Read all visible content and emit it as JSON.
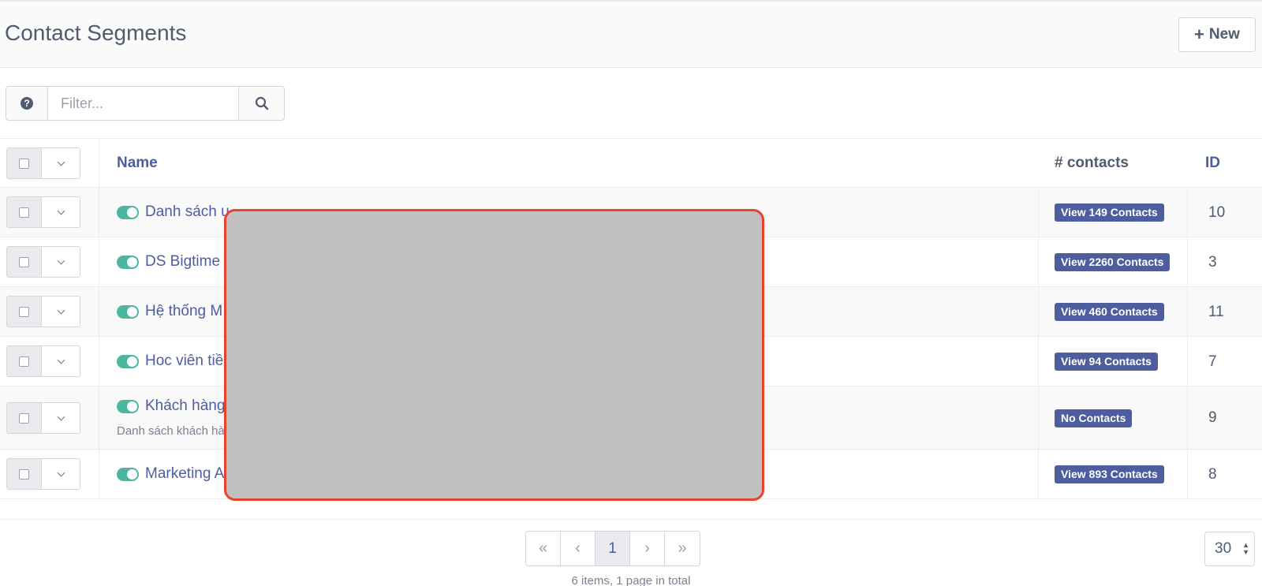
{
  "header": {
    "title": "Contact Segments",
    "new_label": "New"
  },
  "filter": {
    "placeholder": "Filter..."
  },
  "table": {
    "columns": {
      "name": "Name",
      "contacts": "# contacts",
      "id": "ID"
    },
    "rows": [
      {
        "name": "Danh sách u",
        "description": "",
        "contacts_label": "View 149 Contacts",
        "id": "10"
      },
      {
        "name": "DS Bigtime",
        "description": "",
        "contacts_label": "View 2260 Contacts",
        "id": "3"
      },
      {
        "name": "Hệ thống M",
        "description": "",
        "contacts_label": "View 460 Contacts",
        "id": "11"
      },
      {
        "name": "Hoc viên tiề",
        "description": "",
        "contacts_label": "View 94 Contacts",
        "id": "7"
      },
      {
        "name": "Khách hàng",
        "description": "Danh sách khách hà",
        "contacts_label": "No Contacts",
        "id": "9"
      },
      {
        "name": "Marketing A",
        "description": "",
        "contacts_label": "View 893 Contacts",
        "id": "8"
      }
    ]
  },
  "pagination": {
    "first": "«",
    "prev": "‹",
    "current": "1",
    "next": "›",
    "last": "»",
    "summary": "6 items, 1 page in total",
    "per_page": "30"
  },
  "icons": {
    "help": "question-circle-icon",
    "search": "search-icon",
    "new": "plus-icon",
    "toggle": "toggle-on-icon"
  },
  "colors": {
    "accent": "#4e5d9d",
    "toggle_on": "#4db6a0",
    "redaction_border": "#e8412c",
    "redaction_fill": "#c0c0c0"
  }
}
